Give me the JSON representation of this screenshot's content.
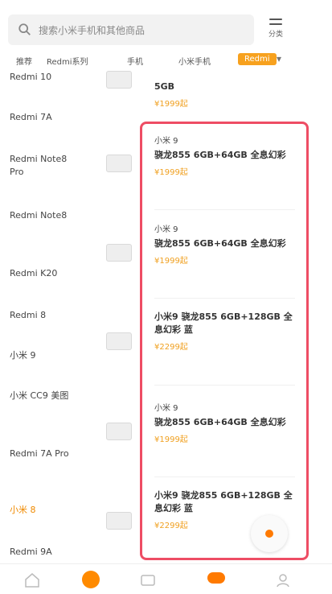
{
  "search": {
    "placeholder": "搜索小米手机和其他商品"
  },
  "menu": {
    "label": "分类"
  },
  "tabs": [
    {
      "label": "推荐"
    },
    {
      "label": "Redmi系列"
    },
    {
      "label": "手机"
    },
    {
      "label": "小米手机"
    },
    {
      "label": "Redmi"
    }
  ],
  "sidebar": {
    "items": [
      {
        "label": "Redmi 10"
      },
      {
        "label": "Redmi 7A"
      },
      {
        "label": "Redmi Note8 Pro"
      },
      {
        "label": "Redmi Note8"
      },
      {
        "label": "Redmi K20"
      },
      {
        "label": "Redmi 8"
      },
      {
        "label": "小米 9"
      },
      {
        "label": "小米 CC9 美图"
      },
      {
        "label": "Redmi 7A Pro"
      },
      {
        "label": "小米 8"
      },
      {
        "label": "Redmi 9A"
      }
    ]
  },
  "products": [
    {
      "tag": "",
      "title": "5GB",
      "price": "¥1999起"
    },
    {
      "tag": "小米 9",
      "title": "骁龙855 6GB+64GB 全息幻彩",
      "price": "¥1999起"
    },
    {
      "tag": "小米 9",
      "title": "骁龙855 6GB+64GB 全息幻彩",
      "price": "¥1999起"
    },
    {
      "tag": "",
      "title": "小米9 骁龙855 6GB+128GB 全息幻彩 蓝",
      "price": "¥2299起"
    },
    {
      "tag": "小米 9",
      "title": "骁龙855 6GB+64GB 全息幻彩",
      "price": "¥1999起"
    },
    {
      "tag": "",
      "title": "小米9 骁龙855 6GB+128GB 全息幻彩 蓝",
      "price": "¥2299起"
    }
  ],
  "colors": {
    "accent": "#f7a11e",
    "highlight": "#ee4d64",
    "price": "#f0a020"
  }
}
